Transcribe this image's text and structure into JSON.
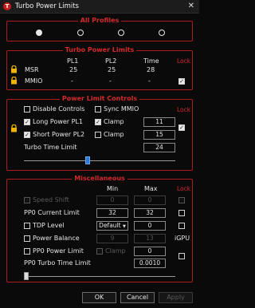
{
  "window": {
    "title": "Turbo Power Limits",
    "close_glyph": "✕",
    "icon_letter": "T"
  },
  "profiles": {
    "title": "All Profiles",
    "selected_index": 0
  },
  "turbo": {
    "title": "Turbo Power Limits",
    "cols": [
      "PL1",
      "PL2",
      "Time"
    ],
    "lock_label": "Lock",
    "rows": [
      {
        "label": "MSR",
        "pl1": "25",
        "pl2": "25",
        "time": "28",
        "lock_checked": false
      },
      {
        "label": "MMIO",
        "pl1": "-",
        "pl2": "-",
        "time": "-",
        "lock_checked": true
      }
    ]
  },
  "plc": {
    "title": "Power Limit Controls",
    "lock_label": "Lock",
    "disable_controls": "Disable Controls",
    "sync_mmio": "Sync MMIO",
    "long_pl1": "Long Power PL1",
    "short_pl2": "Short Power PL2",
    "clamp": "Clamp",
    "pl1_value": "11",
    "pl2_value": "15",
    "turbo_time_label": "Turbo Time Limit",
    "turbo_time_value": "24",
    "slider_fraction": 0.42
  },
  "misc": {
    "title": "Miscellaneous",
    "min_label": "Min",
    "max_label": "Max",
    "lock_label": "Lock",
    "speed_shift": "Speed Shift",
    "speed_shift_min": "0",
    "speed_shift_max": "0",
    "pp0_current": "PP0 Current Limit",
    "pp0_current_min": "32",
    "pp0_current_max": "32",
    "tdp_level": "TDP Level",
    "tdp_default": "Default",
    "tdp_value": "0",
    "power_balance": "Power Balance",
    "pb_min": "9",
    "pb_max": "13",
    "igpu": "iGPU",
    "pp0_power": "PP0 Power Limit",
    "clamp": "Clamp",
    "pp0_power_value": "0",
    "pp0_turbo": "PP0 Turbo Time Limit",
    "pp0_turbo_value": "0.0010",
    "slider_fraction": 0.0
  },
  "buttons": {
    "ok": "OK",
    "cancel": "Cancel",
    "apply": "Apply"
  }
}
